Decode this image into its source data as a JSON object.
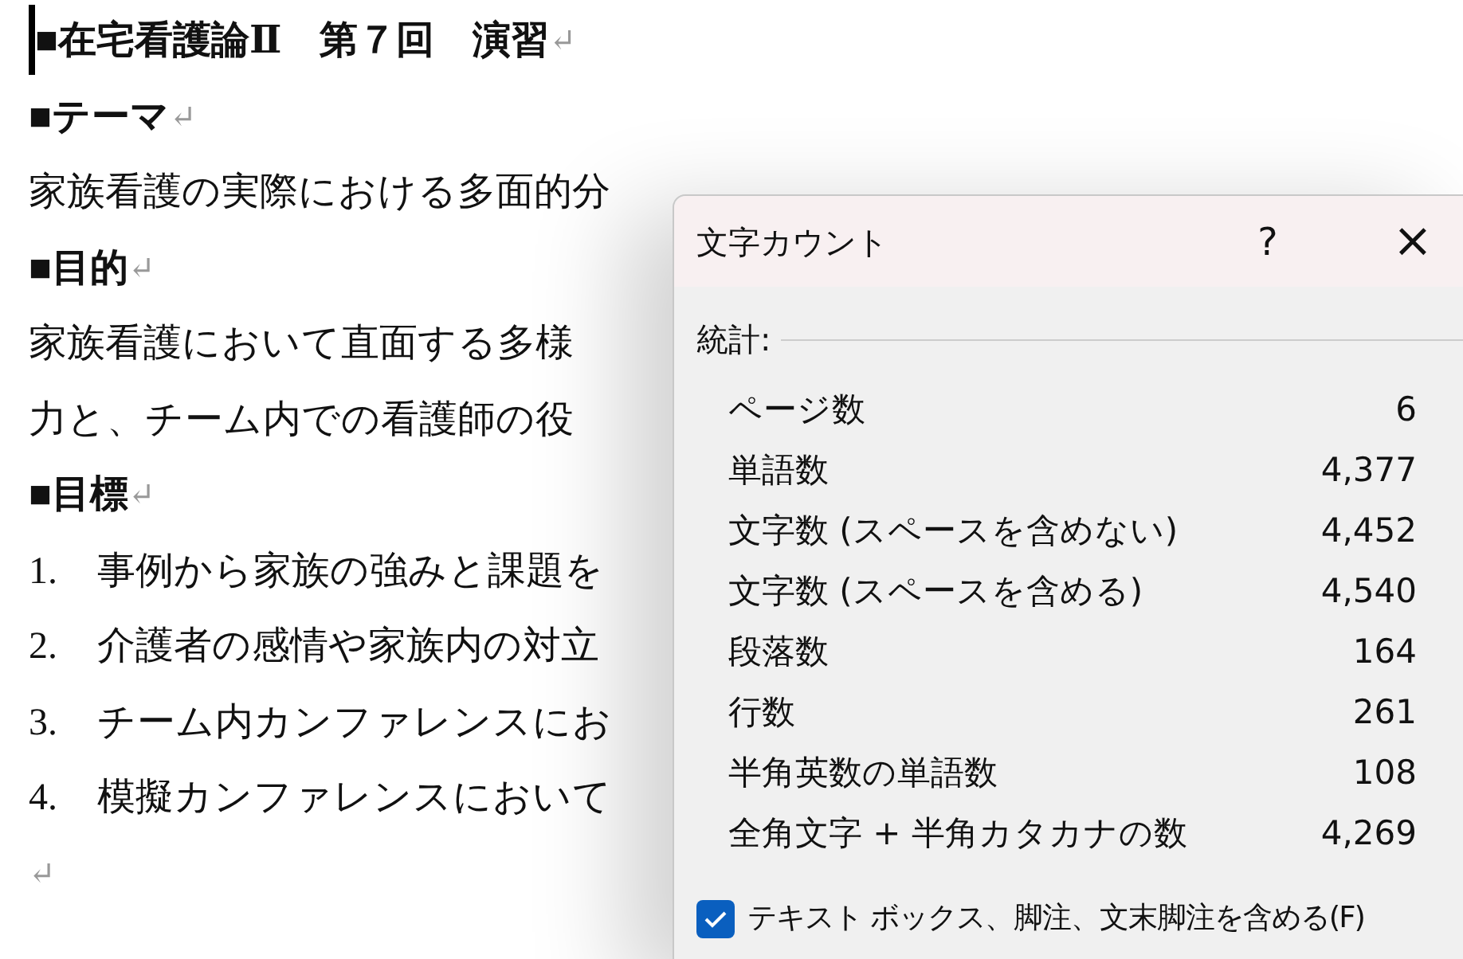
{
  "document": {
    "paragraphs": [
      {
        "kind": "heading",
        "text": "■在宅看護論Ⅱ　第７回　演習",
        "end_mark": "↵",
        "cursor": true
      },
      {
        "kind": "heading",
        "text": "■テーマ",
        "end_mark": "↵"
      },
      {
        "kind": "body",
        "text": "家族看護の実際における多面的分"
      },
      {
        "kind": "heading",
        "text": "■目的",
        "end_mark": "↵"
      },
      {
        "kind": "body",
        "text": "家族看護において直面する多様"
      },
      {
        "kind": "body",
        "text": "力と、チーム内での看護師の役"
      },
      {
        "kind": "heading",
        "text": "■目標",
        "end_mark": "↵"
      },
      {
        "kind": "item",
        "number": "1.",
        "text": "事例から家族の強みと課題を"
      },
      {
        "kind": "item",
        "number": "2.",
        "text": "介護者の感情や家族内の対立"
      },
      {
        "kind": "item",
        "number": "3.",
        "text": "チーム内カンファレンスにお"
      },
      {
        "kind": "item",
        "number": "4.",
        "text": "模擬カンファレンスにおいて"
      },
      {
        "kind": "empty",
        "end_mark": "↵"
      }
    ]
  },
  "dialog": {
    "title": "文字カウント",
    "help": "?",
    "close": "×",
    "section": "統計:",
    "stats": [
      {
        "label": "ページ数",
        "value": "6"
      },
      {
        "label": "単語数",
        "value": "4,377"
      },
      {
        "label": "文字数 (スペースを含めない)",
        "value": "4,452"
      },
      {
        "label": "文字数 (スペースを含める)",
        "value": "4,540"
      },
      {
        "label": "段落数",
        "value": "164"
      },
      {
        "label": "行数",
        "value": "261"
      },
      {
        "label": "半角英数の単語数",
        "value": "108"
      },
      {
        "label": "全角文字 + 半角カタカナの数",
        "value": "4,269"
      }
    ],
    "checkbox": {
      "label": "テキスト ボックス、脚注、文末脚注を含める(F)",
      "checked": true
    }
  }
}
